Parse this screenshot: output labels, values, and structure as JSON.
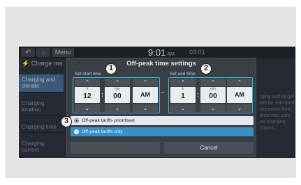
{
  "statusbar": {
    "menu_label": "Menu",
    "time": "9:01",
    "time_ampm": "AM",
    "time2": "03:01"
  },
  "background": {
    "title": "Charge ma",
    "sidebar": [
      {
        "label": "Charging and climate"
      },
      {
        "label": "Charging location"
      },
      {
        "label": "Charging time"
      },
      {
        "label": "Charging current"
      }
    ],
    "right_text": "rging and target will be activated departure time. time may vary on charging ditions."
  },
  "dialog": {
    "title": "Off-peak time settings",
    "start_label": "Set start time",
    "end_label": "Set end time",
    "hour_unit": "h",
    "min_unit": "min",
    "start": {
      "hour": "12",
      "minute": "00",
      "ampm": "AM"
    },
    "end": {
      "hour": "1",
      "minute": "00",
      "ampm": "AM"
    },
    "options": [
      {
        "label": "Off-peak tariffs prioritised",
        "selected": true
      },
      {
        "label": "Off-peak tariffs only",
        "selected": false
      }
    ],
    "ok_label": "",
    "cancel_label": "Cancel"
  },
  "callouts": [
    "1",
    "2",
    "3"
  ]
}
